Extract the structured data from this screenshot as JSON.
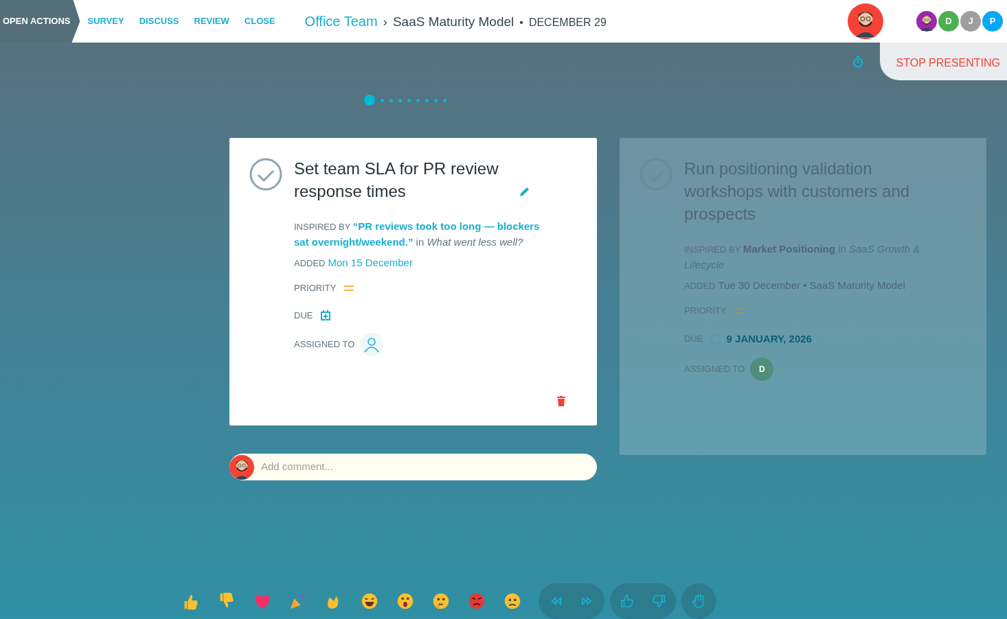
{
  "tabs": [
    {
      "label": "OPEN ACTIONS",
      "selected": true
    },
    {
      "label": "SURVEY",
      "selected": false
    },
    {
      "label": "DISCUSS",
      "selected": false
    },
    {
      "label": "REVIEW",
      "selected": false
    },
    {
      "label": "CLOSE",
      "selected": false
    }
  ],
  "breadcrumb": {
    "team": "Office Team",
    "separator": "›",
    "board": "SaaS Maturity Model",
    "dot": "•",
    "date": "DECEMBER 29"
  },
  "participants": [
    {
      "kind": "avatar",
      "color": "#9c27b0"
    },
    {
      "kind": "initial",
      "initial": "D",
      "color": "#4caf50"
    },
    {
      "kind": "initial",
      "initial": "J",
      "color": "#9e9e9e"
    },
    {
      "kind": "initial",
      "initial": "P",
      "color": "#03a9f4"
    }
  ],
  "stop_presenting": "STOP PRESENTING",
  "pager": [
    {
      "selected": true
    },
    {
      "selected": false
    },
    {
      "selected": false
    },
    {
      "selected": false
    },
    {
      "selected": false
    },
    {
      "selected": false
    },
    {
      "selected": false
    },
    {
      "selected": false
    },
    {
      "selected": false
    }
  ],
  "cards": [
    {
      "focused": true,
      "title": "Set team SLA for PR review response times",
      "inspired_label": "INSPIRED BY",
      "source": "“PR reviews took too long — blockers sat overnight/weekend.”",
      "in": "in",
      "section": "What went less well?",
      "added_label": "ADDED",
      "added": "Mon 15 December",
      "priority_label": "PRIORITY",
      "due_label": "DUE",
      "assigned_label": "ASSIGNED TO"
    },
    {
      "focused": false,
      "title": "Run positioning validation workshops with customers and prospects",
      "inspired_label": "INSPIRED BY",
      "source": "Market Positioning",
      "in": "in",
      "section": "SaaS Growth & Lifecycle",
      "added_label": "ADDED",
      "added": "Tue 30 December • SaaS Maturity Model",
      "priority_label": "PRIORITY",
      "due_label": "DUE",
      "due": "9 JANUARY, 2026",
      "assigned_label": "ASSIGNED TO",
      "assignee": "D"
    }
  ],
  "comment": {
    "placeholder": "Add comment..."
  }
}
